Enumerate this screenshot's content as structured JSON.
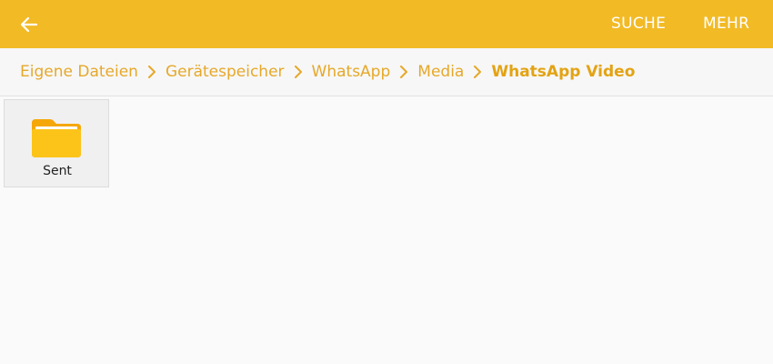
{
  "appbar": {
    "back_icon": "arrow-left-icon",
    "search_label": "SUCHE",
    "more_label": "MEHR",
    "color": "#f2ba25"
  },
  "breadcrumb": {
    "items": [
      {
        "label": "Eigene Dateien"
      },
      {
        "label": "Gerätespeicher"
      },
      {
        "label": "WhatsApp"
      },
      {
        "label": "Media"
      },
      {
        "label": "WhatsApp Video",
        "current": true
      }
    ],
    "separator_icon": "chevron-right-icon",
    "color": "#e6a82a"
  },
  "files": [
    {
      "name": "Sent",
      "type": "folder",
      "icon": "folder-icon",
      "color": "#fcc419"
    }
  ]
}
